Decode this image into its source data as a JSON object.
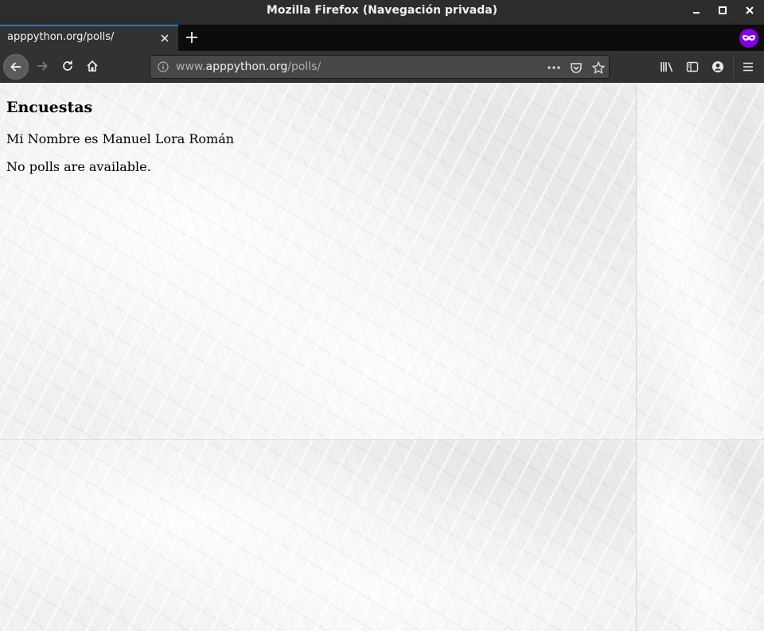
{
  "window": {
    "title": "Mozilla Firefox (Navegación privada)"
  },
  "tabs": [
    {
      "label": "apppython.org/polls/",
      "active": true
    }
  ],
  "navbar": {
    "url_prefix": "www.",
    "url_domain": "apppython.org",
    "url_path": "/polls/"
  },
  "page": {
    "heading": "Encuestas",
    "author_line": "Mi Nombre es Manuel Lora Román",
    "empty_message": "No polls are available."
  },
  "colors": {
    "accent": "#0a84ff",
    "private_badge": "#8000d7",
    "chrome_dark": "#323234"
  }
}
